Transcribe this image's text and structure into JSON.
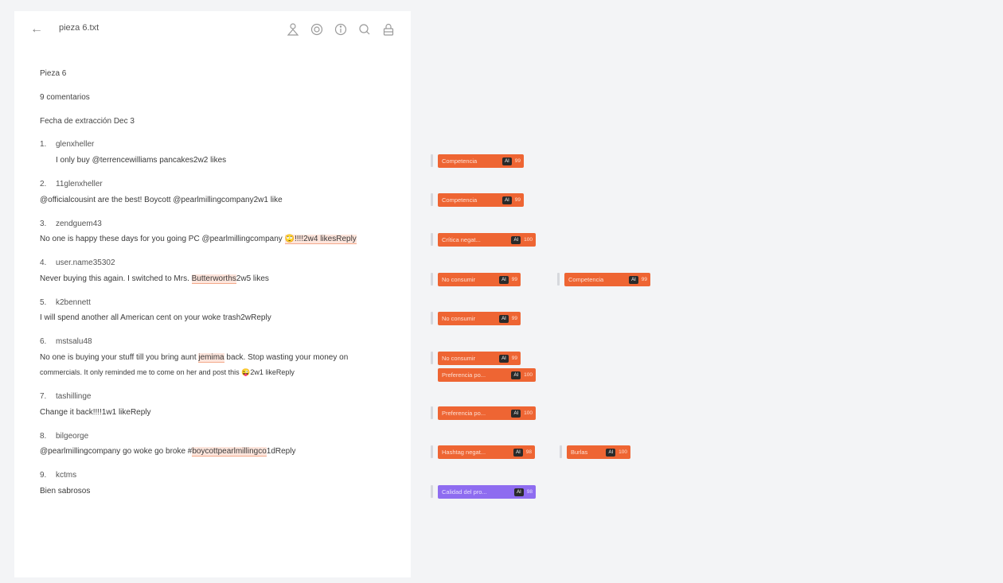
{
  "header": {
    "back_icon": "arrow-left-icon",
    "file_title": "pieza 6.txt",
    "icons": [
      "user-icon",
      "globe-icon",
      "info-icon",
      "search-icon",
      "lock-icon"
    ]
  },
  "document": {
    "title": "Pieza 6",
    "comments_count": "9 comentarios",
    "extraction_date": "Fecha de extracción Dec 3",
    "comments": [
      {
        "num": "1.",
        "user": "glenxheller",
        "text": "I only buy @terrencewilliams pancakes2w2 likes"
      },
      {
        "num": "2.",
        "user": "11glenxheller",
        "text": "@officialcousint are the best! Boycott @pearlmillingcompany2w1 like"
      },
      {
        "num": "3.",
        "user": "zendguem43",
        "text_before": "No one is happy these days for you going PC @pearlmillingcompany ",
        "text_after": "🙄!!!!2w4 likesReply"
      },
      {
        "num": "4.",
        "user": "user.name35302",
        "text_before": "Never buying this again. I switched to Mrs. ",
        "highlight": "Butterworths",
        "text_after": "2w5 likes"
      },
      {
        "num": "5.",
        "user": "k2bennett",
        "text": "I will spend another all American cent on your woke trash2wReply"
      },
      {
        "num": "6.",
        "user": "mstsalu48",
        "text_before": "No one is buying your stuff till you bring aunt ",
        "highlight": "jemima",
        "text_after": " back. Stop wasting your money on",
        "text_line2": "commercials. It only reminded me to come on her and post this 😜2w1 likeReply"
      },
      {
        "num": "7.",
        "user": "tashillinge",
        "text": "Change it back!!!!1w1 likeReply"
      },
      {
        "num": "8.",
        "user": "bilgeorge",
        "text_before": "@pearlmillingcompany go woke go broke #",
        "highlight": "boycottpearlmillingco",
        "text_after": "1dReply"
      },
      {
        "num": "9.",
        "user": "kctms",
        "text": "Bien sabrosos"
      }
    ]
  },
  "annotations": [
    {
      "label": "Competencia",
      "ai": "AI",
      "pct": "99"
    },
    {
      "label": "Competencia",
      "ai": "AI",
      "pct": "99"
    },
    {
      "label": "Crítica negat...",
      "ai": "AI",
      "pct": "100"
    },
    {
      "label": "No consumir",
      "ai": "AI",
      "pct": "99"
    },
    {
      "label": "Competencia",
      "ai": "AI",
      "pct": "99"
    },
    {
      "label": "No consumir",
      "ai": "AI",
      "pct": "99"
    },
    {
      "label": "No consumir",
      "ai": "AI",
      "pct": "99"
    },
    {
      "label": "Preferencia po...",
      "ai": "AI",
      "pct": "100"
    },
    {
      "label": "Preferencia po...",
      "ai": "AI",
      "pct": "100"
    },
    {
      "label": "Hashtag negat...",
      "ai": "AI",
      "pct": "98"
    },
    {
      "label": "Burlas",
      "ai": "AI",
      "pct": "100"
    },
    {
      "label": "Calidad del pro...",
      "ai": "AI",
      "pct": "98"
    }
  ],
  "colors": {
    "tag_orange": "#ee6533",
    "tag_purple": "#8e6cf0",
    "highlight": "#fde5dc"
  }
}
